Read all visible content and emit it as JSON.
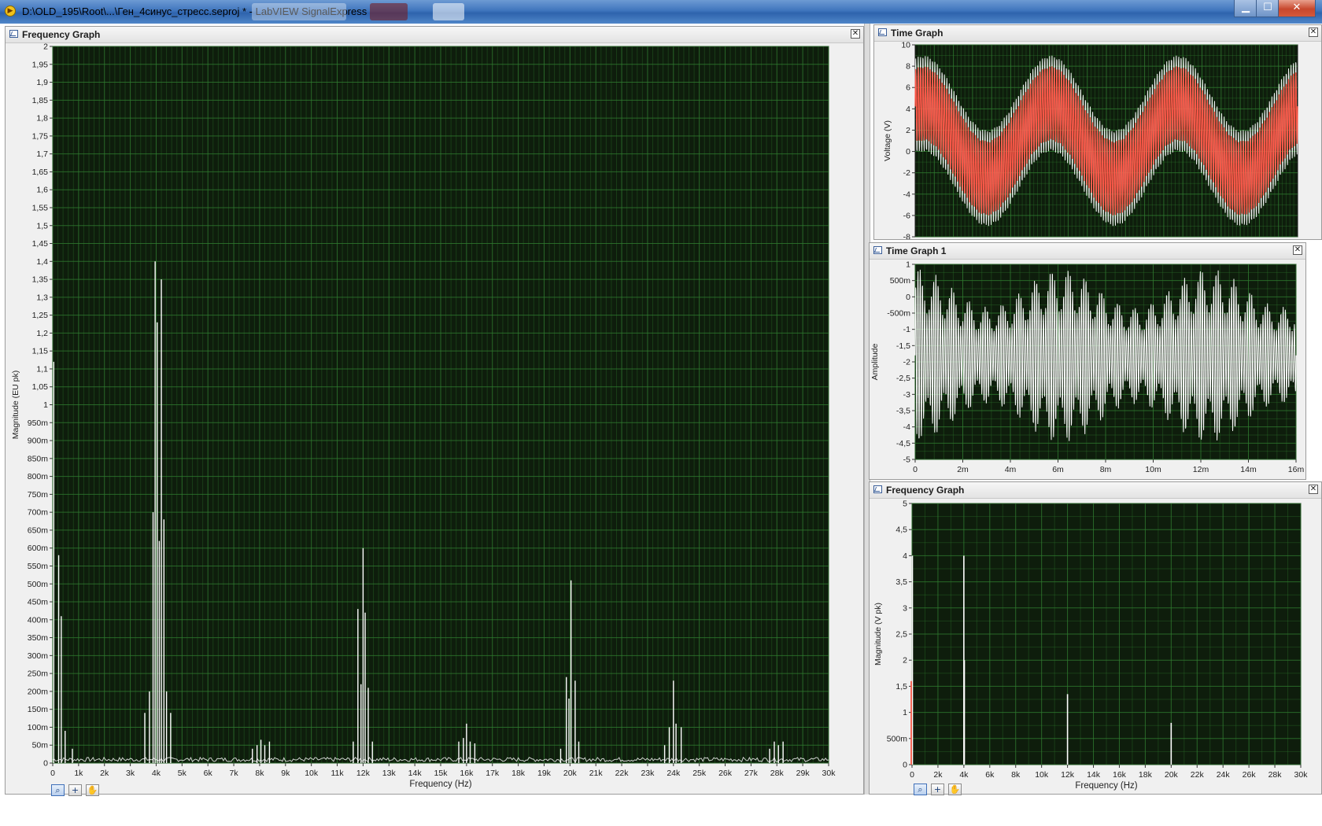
{
  "window": {
    "title": "D:\\OLD_195\\Root\\...\\Ген_4синус_стресс.seproj * - LabVIEW SignalExpress",
    "minimize_glyph": "▁",
    "maximize_glyph": "☐",
    "close_glyph": "✕"
  },
  "icons": {
    "app": "labview-app-icon",
    "graph": "graph-panel-icon",
    "close": "panel-close-icon",
    "zoom": "zoom-tool-icon",
    "cursor": "cursor-tool-icon",
    "pan": "pan-hand-tool-icon"
  },
  "tools": {
    "zoom_glyph": "⌕",
    "cursor_glyph": "+",
    "pan_glyph": "✋"
  },
  "colors": {
    "plot_bg": "#0e1d0c",
    "grid": "#2f7a2f",
    "trace": "#ffffff",
    "trace_red": "#ff4a3a"
  },
  "panels": {
    "freq_main": {
      "title": "Frequency Graph",
      "close_glyph": "✕",
      "chart_data": {
        "type": "line",
        "ylabel": "Magnitude (EU pk)",
        "xlabel": "Frequency (Hz)",
        "xlim": [
          0,
          30000
        ],
        "ylim": [
          0,
          2
        ],
        "yticks": [
          "0",
          "50m",
          "100m",
          "150m",
          "200m",
          "250m",
          "300m",
          "350m",
          "400m",
          "450m",
          "500m",
          "550m",
          "600m",
          "650m",
          "700m",
          "750m",
          "800m",
          "850m",
          "900m",
          "950m",
          "1",
          "1,05",
          "1,1",
          "1,15",
          "1,2",
          "1,25",
          "1,3",
          "1,35",
          "1,4",
          "1,45",
          "1,5",
          "1,55",
          "1,6",
          "1,65",
          "1,7",
          "1,75",
          "1,8",
          "1,85",
          "1,9",
          "1,95",
          "2"
        ],
        "xticks": [
          "0",
          "1k",
          "2k",
          "3k",
          "4k",
          "5k",
          "6k",
          "7k",
          "8k",
          "9k",
          "10k",
          "11k",
          "12k",
          "13k",
          "14k",
          "15k",
          "16k",
          "17k",
          "18k",
          "19k",
          "20k",
          "21k",
          "22k",
          "23k",
          "24k",
          "25k",
          "26k",
          "27k",
          "28k",
          "29k",
          "30k"
        ],
        "peaks": [
          {
            "x": 40,
            "y": 1.12
          },
          {
            "x": 230,
            "y": 0.58
          },
          {
            "x": 330,
            "y": 0.41
          },
          {
            "x": 480,
            "y": 0.09
          },
          {
            "x": 760,
            "y": 0.04
          },
          {
            "x": 3560,
            "y": 0.14
          },
          {
            "x": 3740,
            "y": 0.2
          },
          {
            "x": 3880,
            "y": 0.7
          },
          {
            "x": 3960,
            "y": 1.4
          },
          {
            "x": 4040,
            "y": 1.23
          },
          {
            "x": 4120,
            "y": 0.62
          },
          {
            "x": 4200,
            "y": 1.35
          },
          {
            "x": 4300,
            "y": 0.68
          },
          {
            "x": 4400,
            "y": 0.2
          },
          {
            "x": 4560,
            "y": 0.14
          },
          {
            "x": 7720,
            "y": 0.04
          },
          {
            "x": 7900,
            "y": 0.05
          },
          {
            "x": 8050,
            "y": 0.065
          },
          {
            "x": 8200,
            "y": 0.05
          },
          {
            "x": 8380,
            "y": 0.06
          },
          {
            "x": 11620,
            "y": 0.06
          },
          {
            "x": 11800,
            "y": 0.43
          },
          {
            "x": 11920,
            "y": 0.22
          },
          {
            "x": 12000,
            "y": 0.6
          },
          {
            "x": 12080,
            "y": 0.42
          },
          {
            "x": 12200,
            "y": 0.21
          },
          {
            "x": 12360,
            "y": 0.06
          },
          {
            "x": 15700,
            "y": 0.06
          },
          {
            "x": 15880,
            "y": 0.07
          },
          {
            "x": 16000,
            "y": 0.11
          },
          {
            "x": 16140,
            "y": 0.06
          },
          {
            "x": 16320,
            "y": 0.055
          },
          {
            "x": 19640,
            "y": 0.04
          },
          {
            "x": 19860,
            "y": 0.24
          },
          {
            "x": 19960,
            "y": 0.18
          },
          {
            "x": 20040,
            "y": 0.51
          },
          {
            "x": 20200,
            "y": 0.23
          },
          {
            "x": 20340,
            "y": 0.06
          },
          {
            "x": 23660,
            "y": 0.05
          },
          {
            "x": 23840,
            "y": 0.1
          },
          {
            "x": 24000,
            "y": 0.23
          },
          {
            "x": 24100,
            "y": 0.11
          },
          {
            "x": 24300,
            "y": 0.1
          },
          {
            "x": 27720,
            "y": 0.04
          },
          {
            "x": 27900,
            "y": 0.06
          },
          {
            "x": 28060,
            "y": 0.05
          },
          {
            "x": 28240,
            "y": 0.06
          }
        ]
      }
    },
    "time_graph": {
      "title": "Time Graph",
      "close_glyph": "✕",
      "chart_data": {
        "type": "line",
        "ylabel": "Voltage (V)",
        "ylim": [
          -8,
          10
        ],
        "yticks": [
          "-8",
          "-6",
          "-4",
          "-2",
          "0",
          "2",
          "4",
          "6",
          "8",
          "10"
        ],
        "series": [
          {
            "offset_amplitude": 3.5,
            "mid": 1.0,
            "carrier_amplitude": 4.5,
            "color": "#ffffff",
            "cycles": 3
          },
          {
            "offset_amplitude": 3.5,
            "mid": 1.0,
            "carrier_amplitude": 3.5,
            "color": "#ff4a3a",
            "cycles": 3
          }
        ]
      }
    },
    "time_graph_1": {
      "title": "Time Graph 1",
      "close_glyph": "✕",
      "chart_data": {
        "type": "line",
        "ylabel": "Amplitude",
        "xlim": [
          0,
          0.016
        ],
        "ylim": [
          -5,
          1
        ],
        "yticks": [
          "-5",
          "-4,5",
          "-4",
          "-3,5",
          "-3",
          "-2,5",
          "-2",
          "-1,5",
          "-1",
          "-500m",
          "0",
          "500m",
          "1"
        ],
        "xticks": [
          "0",
          "2m",
          "4m",
          "6m",
          "8m",
          "10m",
          "12m",
          "14m",
          "16m"
        ],
        "signal": {
          "mid": -1.8,
          "amplitude_min": 1.5,
          "amplitude_max": 2.7,
          "color": "#ffffff"
        }
      }
    },
    "freq_small": {
      "title": "Frequency Graph",
      "close_glyph": "✕",
      "chart_data": {
        "type": "line",
        "ylabel": "Magnitude (V pk)",
        "xlabel": "Frequency (Hz)",
        "xlim": [
          0,
          30000
        ],
        "ylim": [
          0,
          5
        ],
        "yticks": [
          "0",
          "500m",
          "1",
          "1,5",
          "2",
          "2,5",
          "3",
          "3,5",
          "4",
          "4,5",
          "5"
        ],
        "xticks": [
          "0",
          "2k",
          "4k",
          "6k",
          "8k",
          "10k",
          "12k",
          "14k",
          "16k",
          "18k",
          "20k",
          "22k",
          "24k",
          "26k",
          "28k",
          "30k"
        ],
        "peaks": [
          {
            "x": 30,
            "y": 4.0,
            "color": "#ffffff"
          },
          {
            "x": 30,
            "y": 1.6,
            "color": "#ff4a3a"
          },
          {
            "x": 4000,
            "y": 4.0,
            "color": "#ffffff"
          },
          {
            "x": 4040,
            "y": 2.0,
            "color": "#ffffff"
          },
          {
            "x": 12000,
            "y": 1.35,
            "color": "#ffffff"
          },
          {
            "x": 20000,
            "y": 0.8,
            "color": "#ffffff"
          }
        ]
      }
    }
  }
}
